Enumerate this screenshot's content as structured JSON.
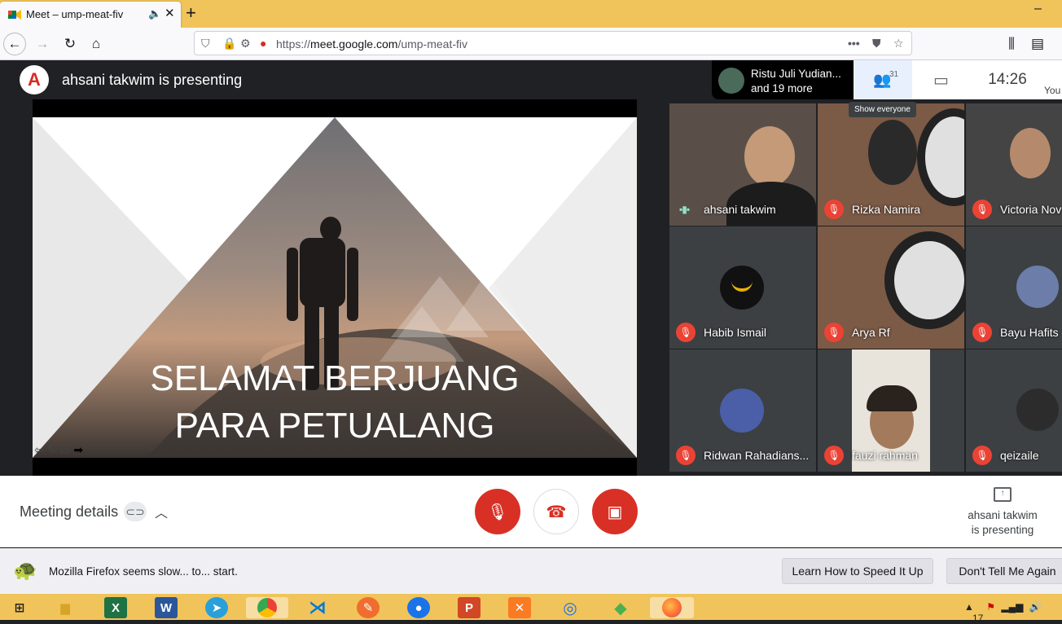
{
  "browser": {
    "tab_title": "Meet – ump-meat-fiv",
    "tab_close": "✕",
    "new_tab": "+",
    "url_domain": "meet.google.com",
    "url_prefix": "https://",
    "url_path": "/ump-meat-fiv",
    "url_menu": "•••"
  },
  "meet": {
    "presenting_title": "ahsani takwim is presenting",
    "presenter_logo_letter": "A",
    "participants_summary_line1": "Ristu Juli Yudian...",
    "participants_summary_line2": "and 19 more",
    "people_count": "31",
    "clock": "14:26",
    "you_label": "You",
    "tooltip": "Show everyone"
  },
  "slide": {
    "line1": "SELAMAT BERJUANG",
    "line2": "PARA PETUALANG"
  },
  "tiles": [
    {
      "name": "ahsani takwim",
      "muted": false,
      "speaking": true
    },
    {
      "name": "Rizka Namira",
      "muted": true
    },
    {
      "name": "Victoria Nov",
      "muted": true
    },
    {
      "name": "Habib Ismail",
      "muted": true
    },
    {
      "name": "Arya Rf",
      "muted": true
    },
    {
      "name": "Bayu Hafits",
      "muted": true
    },
    {
      "name": "Ridwan Rahadians...",
      "muted": true
    },
    {
      "name": "fauzi rahman",
      "muted": true
    },
    {
      "name": "qeizaile",
      "muted": true
    }
  ],
  "bottom": {
    "meeting_details": "Meeting details",
    "presenting_line1": "ahsani takwim",
    "presenting_line2": "is presenting"
  },
  "notification": {
    "text": "Mozilla Firefox seems slow... to... start.",
    "learn_button": "Learn How to Speed It Up",
    "dont_tell_button": "Don't Tell Me Again"
  },
  "taskbar": {
    "apps": [
      "start",
      "file-explorer",
      "excel",
      "word",
      "telegram",
      "chrome",
      "vscode",
      "app-pen",
      "maps",
      "powerpoint",
      "xampp",
      "app-rings",
      "app-diamond",
      "firefox"
    ],
    "tray_time": "17"
  },
  "colors": {
    "red": "#d93025",
    "tabbar": "#f0c45b",
    "meet_bg": "#202124"
  }
}
